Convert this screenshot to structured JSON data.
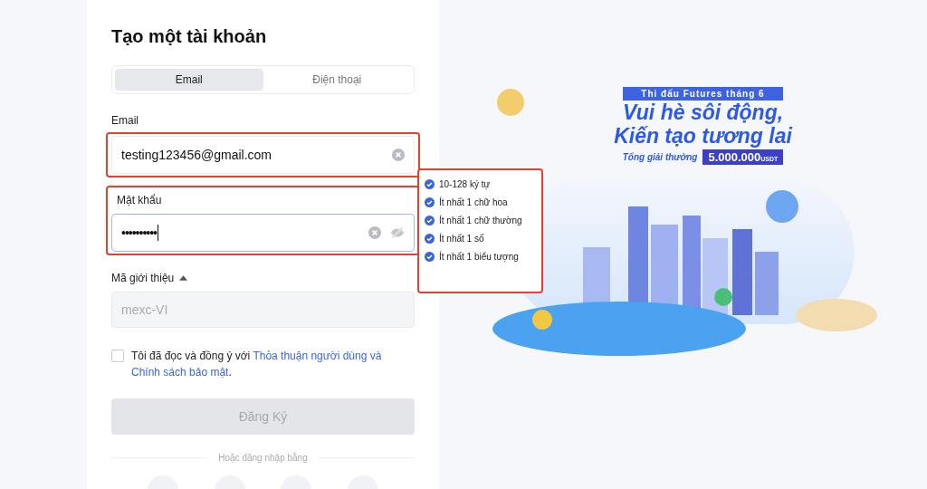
{
  "title": "Tạo một tài khoản",
  "tabs": [
    {
      "label": "Email",
      "selected": true
    },
    {
      "label": "Điện thoại",
      "selected": false
    }
  ],
  "email": {
    "label": "Email",
    "value": "testing123456@gmail.com",
    "highlighted": true
  },
  "password": {
    "label": "Mật khẩu",
    "value": "••••••••••",
    "focused": true,
    "highlighted": true
  },
  "referral": {
    "label": "Mã giới thiệu",
    "expanded": true,
    "placeholder": "mexc-VI"
  },
  "terms": {
    "checked": false,
    "text": "Tôi đã đọc và đồng ý với ",
    "links": [
      "Thỏa thuận người dùng và",
      "Chính sách bảo mật"
    ],
    "end": "."
  },
  "submit": {
    "label": "Đăng Ký",
    "disabled": true
  },
  "divider": "Hoặc đăng nhập bằng",
  "password_rules": {
    "highlighted": true,
    "items": [
      {
        "label": "10-128 ký tự",
        "met": true
      },
      {
        "label": "Ít nhất 1 chữ hoa",
        "met": true
      },
      {
        "label": "Ít nhất 1 chữ thường",
        "met": true
      },
      {
        "label": "Ít nhất 1 số",
        "met": true
      },
      {
        "label": "Ít nhất 1 biểu tượng",
        "met": true
      }
    ]
  },
  "banner": {
    "subtitle": "Thi đấu Futures tháng 6",
    "headline": [
      "Vui hè sôi động,",
      "Kiến tạo tương lai"
    ],
    "prize_label": "Tổng giải thưởng",
    "prize_amount": "5.000.000",
    "prize_unit": "USDT"
  }
}
